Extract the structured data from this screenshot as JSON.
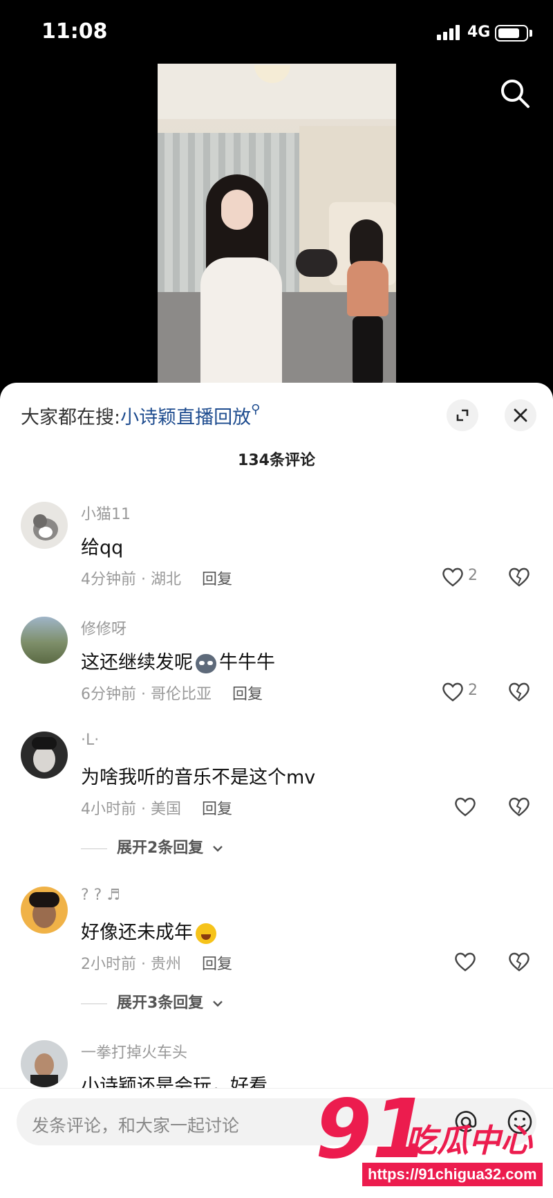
{
  "status": {
    "time": "11:08",
    "network": "4G",
    "battery_level": 0.8
  },
  "hot_search": {
    "prefix": "大家都在搜:",
    "term": "小诗颖直播回放"
  },
  "comments_header": {
    "count_label": "134条评论"
  },
  "comments": [
    {
      "user": "小猫11",
      "text": "给qq",
      "time_location": "4分钟前 · 湖北",
      "reply_label": "回复",
      "likes": "2",
      "expand_label": ""
    },
    {
      "user": "修修呀",
      "text_before": "这还继续发呢",
      "text_after": "牛牛牛",
      "time_location": "6分钟前 · 哥伦比亚",
      "reply_label": "回复",
      "likes": "2",
      "emoji": "cat-face"
    },
    {
      "user": "·L·",
      "text": "为啥我听的音乐不是这个mv",
      "time_location": "4小时前 · 美国",
      "reply_label": "回复",
      "likes": "",
      "expand_label": "展开2条回复"
    },
    {
      "user": "? ? ♬",
      "text": "好像还未成年",
      "time_location": "2小时前 · 贵州",
      "reply_label": "回复",
      "likes": "",
      "expand_label": "展开3条回复",
      "emoji": "crying-laughing"
    },
    {
      "user": "一拳打掉火车头",
      "text": "小诗颖还是会玩，好看"
    }
  ],
  "input": {
    "placeholder": "发条评论，和大家一起讨论"
  },
  "watermark": {
    "number": "91",
    "name": "吃瓜中心",
    "url": "https://91chigua32.com"
  },
  "colors": {
    "link": "#1e4c8f",
    "watermark": "#ec1c4e",
    "meta": "#999999"
  },
  "icons": [
    "search-icon",
    "expand-icon",
    "close-icon",
    "heart-icon",
    "broken-heart-icon",
    "at-icon",
    "emoji-icon",
    "chevron-down-icon"
  ]
}
